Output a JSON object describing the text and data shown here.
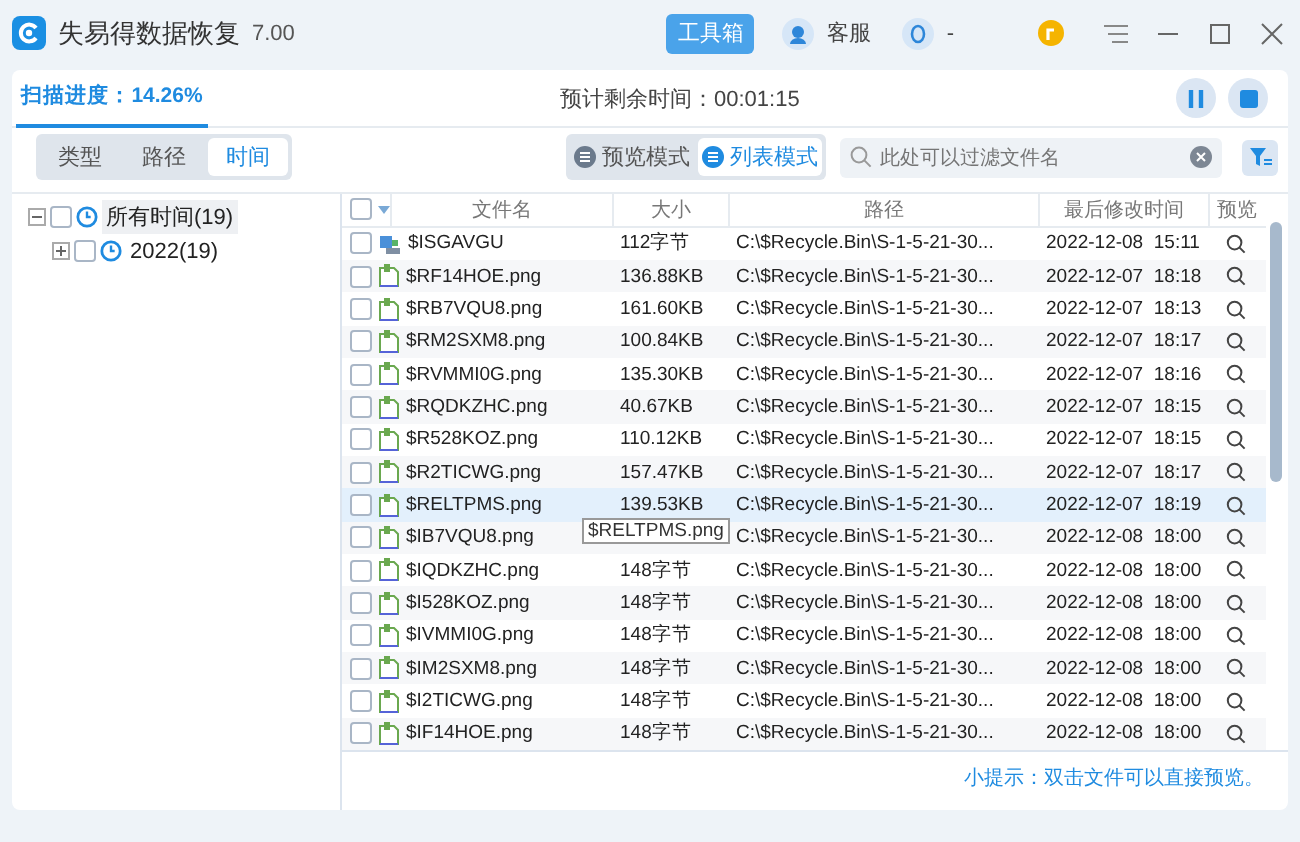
{
  "window": {
    "app_name": "失易得数据恢复",
    "version": "7.00",
    "toolbox_button": "工具箱",
    "service_label": "客服",
    "user_label": "-"
  },
  "scan": {
    "progress_label": "扫描进度：14.26%",
    "remaining": "预计剩余时间：00:01:15"
  },
  "view_tabs": [
    {
      "label": "类型",
      "selected": false
    },
    {
      "label": "路径",
      "selected": false
    },
    {
      "label": "时间",
      "selected": true
    }
  ],
  "modes": [
    {
      "label": "预览模式",
      "selected": false
    },
    {
      "label": "列表模式",
      "selected": true
    }
  ],
  "search": {
    "placeholder": "此处可以过滤文件名"
  },
  "tree": [
    {
      "label": "所有时间(19)",
      "expanded": true,
      "checked": false,
      "selected": true,
      "children": [
        {
          "label": "2022(19)",
          "expanded": false,
          "checked": false,
          "selected": false
        }
      ]
    }
  ],
  "table": {
    "select_all_checked": false,
    "columns": [
      "文件名",
      "大小",
      "路径",
      "最后修改时间",
      "预览"
    ],
    "rows": [
      {
        "kind": "system",
        "name": "$ISGAVGU",
        "size": "112字节",
        "path": "C:\\$Recycle.Bin\\S-1-5-21-30...",
        "date": "2022-12-08",
        "time": "15:11",
        "checked": false,
        "selected": false
      },
      {
        "kind": "image",
        "name": "$RF14HOE.png",
        "size": "136.88KB",
        "path": "C:\\$Recycle.Bin\\S-1-5-21-30...",
        "date": "2022-12-07",
        "time": "18:18",
        "checked": false,
        "selected": false
      },
      {
        "kind": "image",
        "name": "$RB7VQU8.png",
        "size": "161.60KB",
        "path": "C:\\$Recycle.Bin\\S-1-5-21-30...",
        "date": "2022-12-07",
        "time": "18:13",
        "checked": false,
        "selected": false
      },
      {
        "kind": "image",
        "name": "$RM2SXM8.png",
        "size": "100.84KB",
        "path": "C:\\$Recycle.Bin\\S-1-5-21-30...",
        "date": "2022-12-07",
        "time": "18:17",
        "checked": false,
        "selected": false
      },
      {
        "kind": "image",
        "name": "$RVMMI0G.png",
        "size": "135.30KB",
        "path": "C:\\$Recycle.Bin\\S-1-5-21-30...",
        "date": "2022-12-07",
        "time": "18:16",
        "checked": false,
        "selected": false
      },
      {
        "kind": "image",
        "name": "$RQDKZHC.png",
        "size": "40.67KB",
        "path": "C:\\$Recycle.Bin\\S-1-5-21-30...",
        "date": "2022-12-07",
        "time": "18:15",
        "checked": false,
        "selected": false
      },
      {
        "kind": "image",
        "name": "$R528KOZ.png",
        "size": "110.12KB",
        "path": "C:\\$Recycle.Bin\\S-1-5-21-30...",
        "date": "2022-12-07",
        "time": "18:15",
        "checked": false,
        "selected": false
      },
      {
        "kind": "image",
        "name": "$R2TICWG.png",
        "size": "157.47KB",
        "path": "C:\\$Recycle.Bin\\S-1-5-21-30...",
        "date": "2022-12-07",
        "time": "18:17",
        "checked": false,
        "selected": false
      },
      {
        "kind": "image",
        "name": "$RELTPMS.png",
        "size": "139.53KB",
        "path": "C:\\$Recycle.Bin\\S-1-5-21-30...",
        "date": "2022-12-07",
        "time": "18:19",
        "checked": false,
        "selected": true,
        "tooltip": "$RELTPMS.png"
      },
      {
        "kind": "image",
        "name": "$IB7VQU8.png",
        "path": "C:\\$Recycle.Bin\\S-1-5-21-30...",
        "date": "2022-12-08",
        "time": "18:00",
        "checked": false,
        "selected": false
      },
      {
        "kind": "image",
        "name": "$IQDKZHC.png",
        "size": "148字节",
        "path": "C:\\$Recycle.Bin\\S-1-5-21-30...",
        "date": "2022-12-08",
        "time": "18:00",
        "checked": false,
        "selected": false
      },
      {
        "kind": "image",
        "name": "$I528KOZ.png",
        "size": "148字节",
        "path": "C:\\$Recycle.Bin\\S-1-5-21-30...",
        "date": "2022-12-08",
        "time": "18:00",
        "checked": false,
        "selected": false
      },
      {
        "kind": "image",
        "name": "$IVMMI0G.png",
        "size": "148字节",
        "path": "C:\\$Recycle.Bin\\S-1-5-21-30...",
        "date": "2022-12-08",
        "time": "18:00",
        "checked": false,
        "selected": false
      },
      {
        "kind": "image",
        "name": "$IM2SXM8.png",
        "size": "148字节",
        "path": "C:\\$Recycle.Bin\\S-1-5-21-30...",
        "date": "2022-12-08",
        "time": "18:00",
        "checked": false,
        "selected": false
      },
      {
        "kind": "image",
        "name": "$I2TICWG.png",
        "size": "148字节",
        "path": "C:\\$Recycle.Bin\\S-1-5-21-30...",
        "date": "2022-12-08",
        "time": "18:00",
        "checked": false,
        "selected": false
      },
      {
        "kind": "image",
        "name": "$IF14HOE.png",
        "size": "148字节",
        "path": "C:\\$Recycle.Bin\\S-1-5-21-30...",
        "date": "2022-12-08",
        "time": "18:00",
        "checked": false,
        "selected": false
      }
    ]
  },
  "hint": "小提示：双击文件可以直接预览。"
}
